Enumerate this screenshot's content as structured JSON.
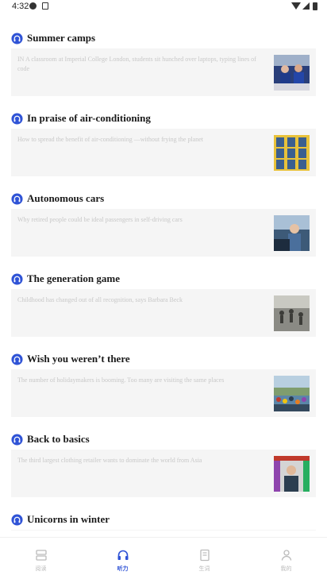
{
  "status_bar": {
    "time": "4:32"
  },
  "colors": {
    "accent": "#2f53d6",
    "card_bg": "#f5f5f5",
    "muted_text": "#c8c8c8",
    "nav_inactive": "#bbbbbb"
  },
  "articles": [
    {
      "title": "Summer camps",
      "summary": "IN A classroom at Imperial College London, students sit hunched over laptops, typing lines of code",
      "thumb": "students-photo"
    },
    {
      "title": "In praise of air-conditioning",
      "summary": "How to spread the benefit of air-conditioning —without frying the planet",
      "thumb": "air-conditioners-photo"
    },
    {
      "title": "Autonomous cars",
      "summary": "Why retired people could be ideal passengers in self-driving cars",
      "thumb": "elderly-passenger-photo"
    },
    {
      "title": "The generation game",
      "summary": "Childhood has changed out of all recognition, says Barbara Beck",
      "thumb": "children-playing-photo"
    },
    {
      "title": "Wish you weren’t there",
      "summary": "The number of holidaymakers is booming. Too many are visiting the same places",
      "thumb": "crowded-tourists-photo"
    },
    {
      "title": "Back to basics",
      "summary": "The third largest clothing retailer wants to dominate the world from Asia",
      "thumb": "retailer-ceo-photo"
    },
    {
      "title": "Unicorns in winter",
      "summary": "",
      "thumb": ""
    }
  ],
  "nav": [
    {
      "label": "阅读",
      "icon": "stack-icon",
      "active": false
    },
    {
      "label": "听力",
      "icon": "headphones-icon",
      "active": true
    },
    {
      "label": "生词",
      "icon": "book-icon",
      "active": false
    },
    {
      "label": "我的",
      "icon": "person-icon",
      "active": false
    }
  ]
}
